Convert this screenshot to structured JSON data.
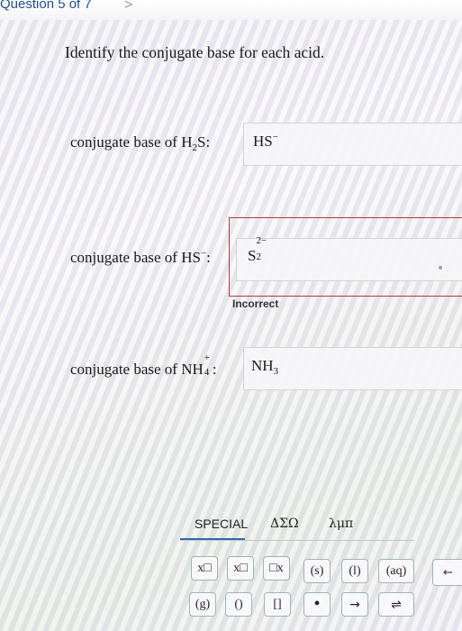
{
  "header": {
    "question_label": "Question 5 of 7",
    "next_glyph": ">"
  },
  "prompt": "Identify the conjugate base for each acid.",
  "rows": [
    {
      "label_main": "conjugate base of H",
      "label_sub": "2",
      "label_tail": "S:",
      "answer_main": "HS",
      "answer_sup": "−",
      "answer_sub": ""
    },
    {
      "label_main": "conjugate base of HS",
      "label_sup": "−",
      "label_tail": ":",
      "answer_main": "S",
      "answer_sup": "2−",
      "answer_sub": "2",
      "feedback": "Incorrect"
    },
    {
      "label_main": "conjugate base of NH",
      "label_sub": "4",
      "label_sup": "+",
      "label_tail": ":",
      "answer_main": "NH",
      "answer_sub": "3",
      "answer_sup": ""
    }
  ],
  "palette": {
    "tabs": [
      "SPECIAL",
      "ΔΣΩ",
      "λμπ"
    ],
    "active_tab": "SPECIAL",
    "keys_row1": [
      "x□",
      "x□",
      "□x",
      "(s)",
      "(l)",
      "(aq)"
    ],
    "keys_row2": [
      "(g)",
      "()",
      "[]",
      "•",
      "→",
      "⇌"
    ],
    "back_glyph": "←"
  },
  "colors": {
    "accent": "#2a6bb3",
    "error": "#b63a3a",
    "header_text": "#1d4f8a"
  }
}
